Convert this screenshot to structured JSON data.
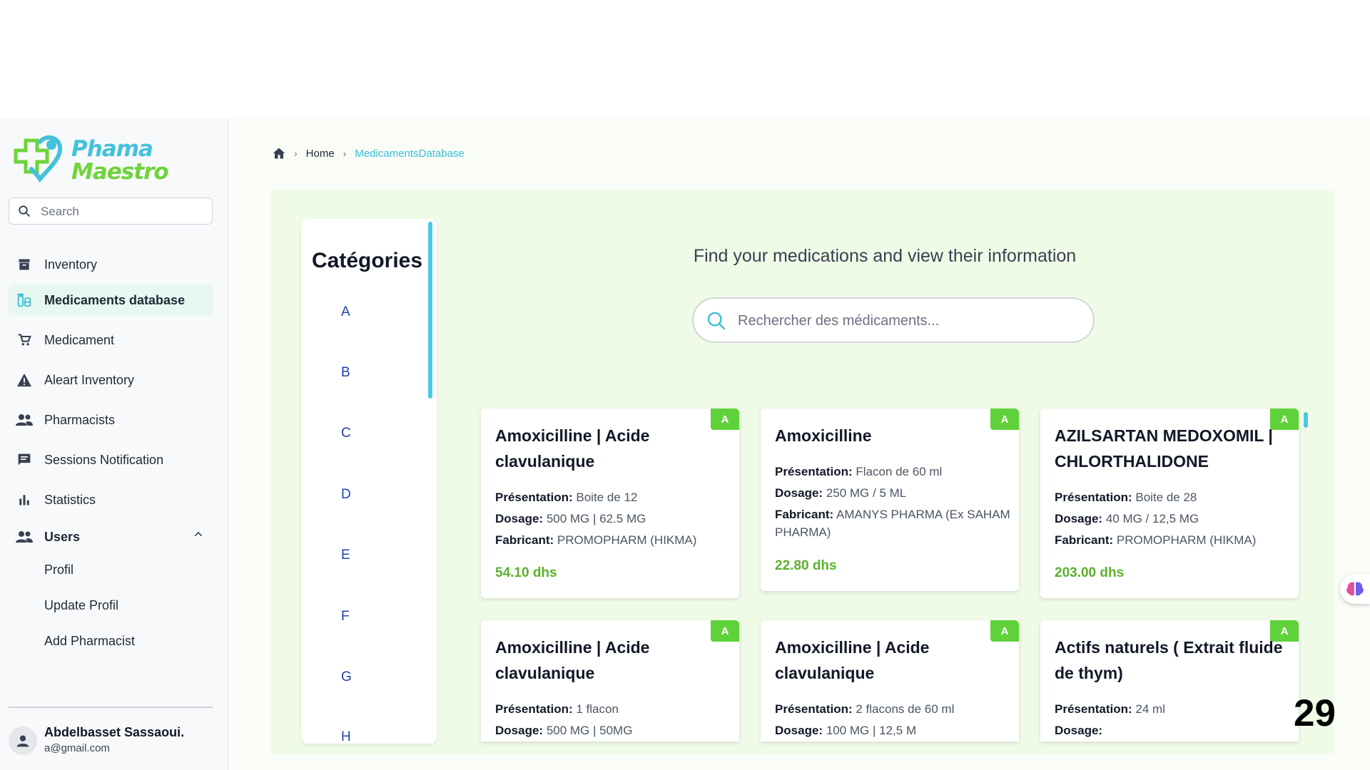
{
  "brand": {
    "line1": "Phama",
    "line2": "Maestro",
    "primary_color": "#43c1dc",
    "secondary_color": "#6fd33a"
  },
  "sidebar": {
    "search_placeholder": "Search",
    "items": [
      {
        "label": "Inventory",
        "icon": "archive-icon"
      },
      {
        "label": "Medicaments database",
        "icon": "pills-icon",
        "active": true
      },
      {
        "label": "Medicament",
        "icon": "cart-icon"
      },
      {
        "label": "Aleart Inventory",
        "icon": "warning-icon"
      },
      {
        "label": "Pharmacists",
        "icon": "people-icon"
      },
      {
        "label": "Sessions Notification",
        "icon": "chat-icon"
      },
      {
        "label": "Statistics",
        "icon": "bar-chart-icon"
      },
      {
        "label": "Users",
        "icon": "users-icon",
        "expanded": true
      }
    ],
    "sub_items": [
      "Profil",
      "Update Profil",
      "Add Pharmacist"
    ],
    "user": {
      "name": "Abdelbasset Sassaoui.",
      "email": "a@gmail.com"
    }
  },
  "breadcrumb": {
    "home": "Home",
    "current": "MedicamentsDatabase"
  },
  "categories": {
    "title": "Catégories",
    "letters": [
      "A",
      "B",
      "C",
      "D",
      "E",
      "F",
      "G",
      "H"
    ]
  },
  "main": {
    "heading": "Find your medications and view their information",
    "search_placeholder": "Rechercher des médicaments..."
  },
  "labels": {
    "presentation": "Présentation:",
    "dosage": "Dosage:",
    "fabricant": "Fabricant:"
  },
  "medications": [
    {
      "badge": "A",
      "name": "Amoxicilline | Acide clavulanique",
      "presentation": "Boite de 12",
      "dosage": "500 MG  | 62.5 MG",
      "fabricant": "PROMOPHARM (HIKMA)",
      "price": "54.10 dhs"
    },
    {
      "badge": "A",
      "name": "Amoxicilline",
      "presentation": "Flacon de 60 ml",
      "dosage": "250 MG / 5 ML",
      "fabricant": "AMANYS PHARMA (Ex SAHAM PHARMA)",
      "price": "22.80 dhs"
    },
    {
      "badge": "A",
      "name": "AZILSARTAN MEDOXOMIL | CHLORTHALIDONE",
      "presentation": "Boite de 28",
      "dosage": "40 MG / 12,5 MG",
      "fabricant": "PROMOPHARM (HIKMA)",
      "price": "203.00 dhs"
    },
    {
      "badge": "A",
      "name": "Amoxicilline | Acide clavulanique",
      "presentation": "1 flacon",
      "dosage": "500 MG | 50MG"
    },
    {
      "badge": "A",
      "name": "Amoxicilline | Acide clavulanique",
      "presentation": "2 flacons de 60 ml",
      "dosage": "100 MG  | 12,5 M"
    },
    {
      "badge": "A",
      "name": "Actifs naturels ( Extrait fluide de thym)",
      "presentation": "24 ml",
      "dosage": ""
    }
  ],
  "page_number": "29"
}
